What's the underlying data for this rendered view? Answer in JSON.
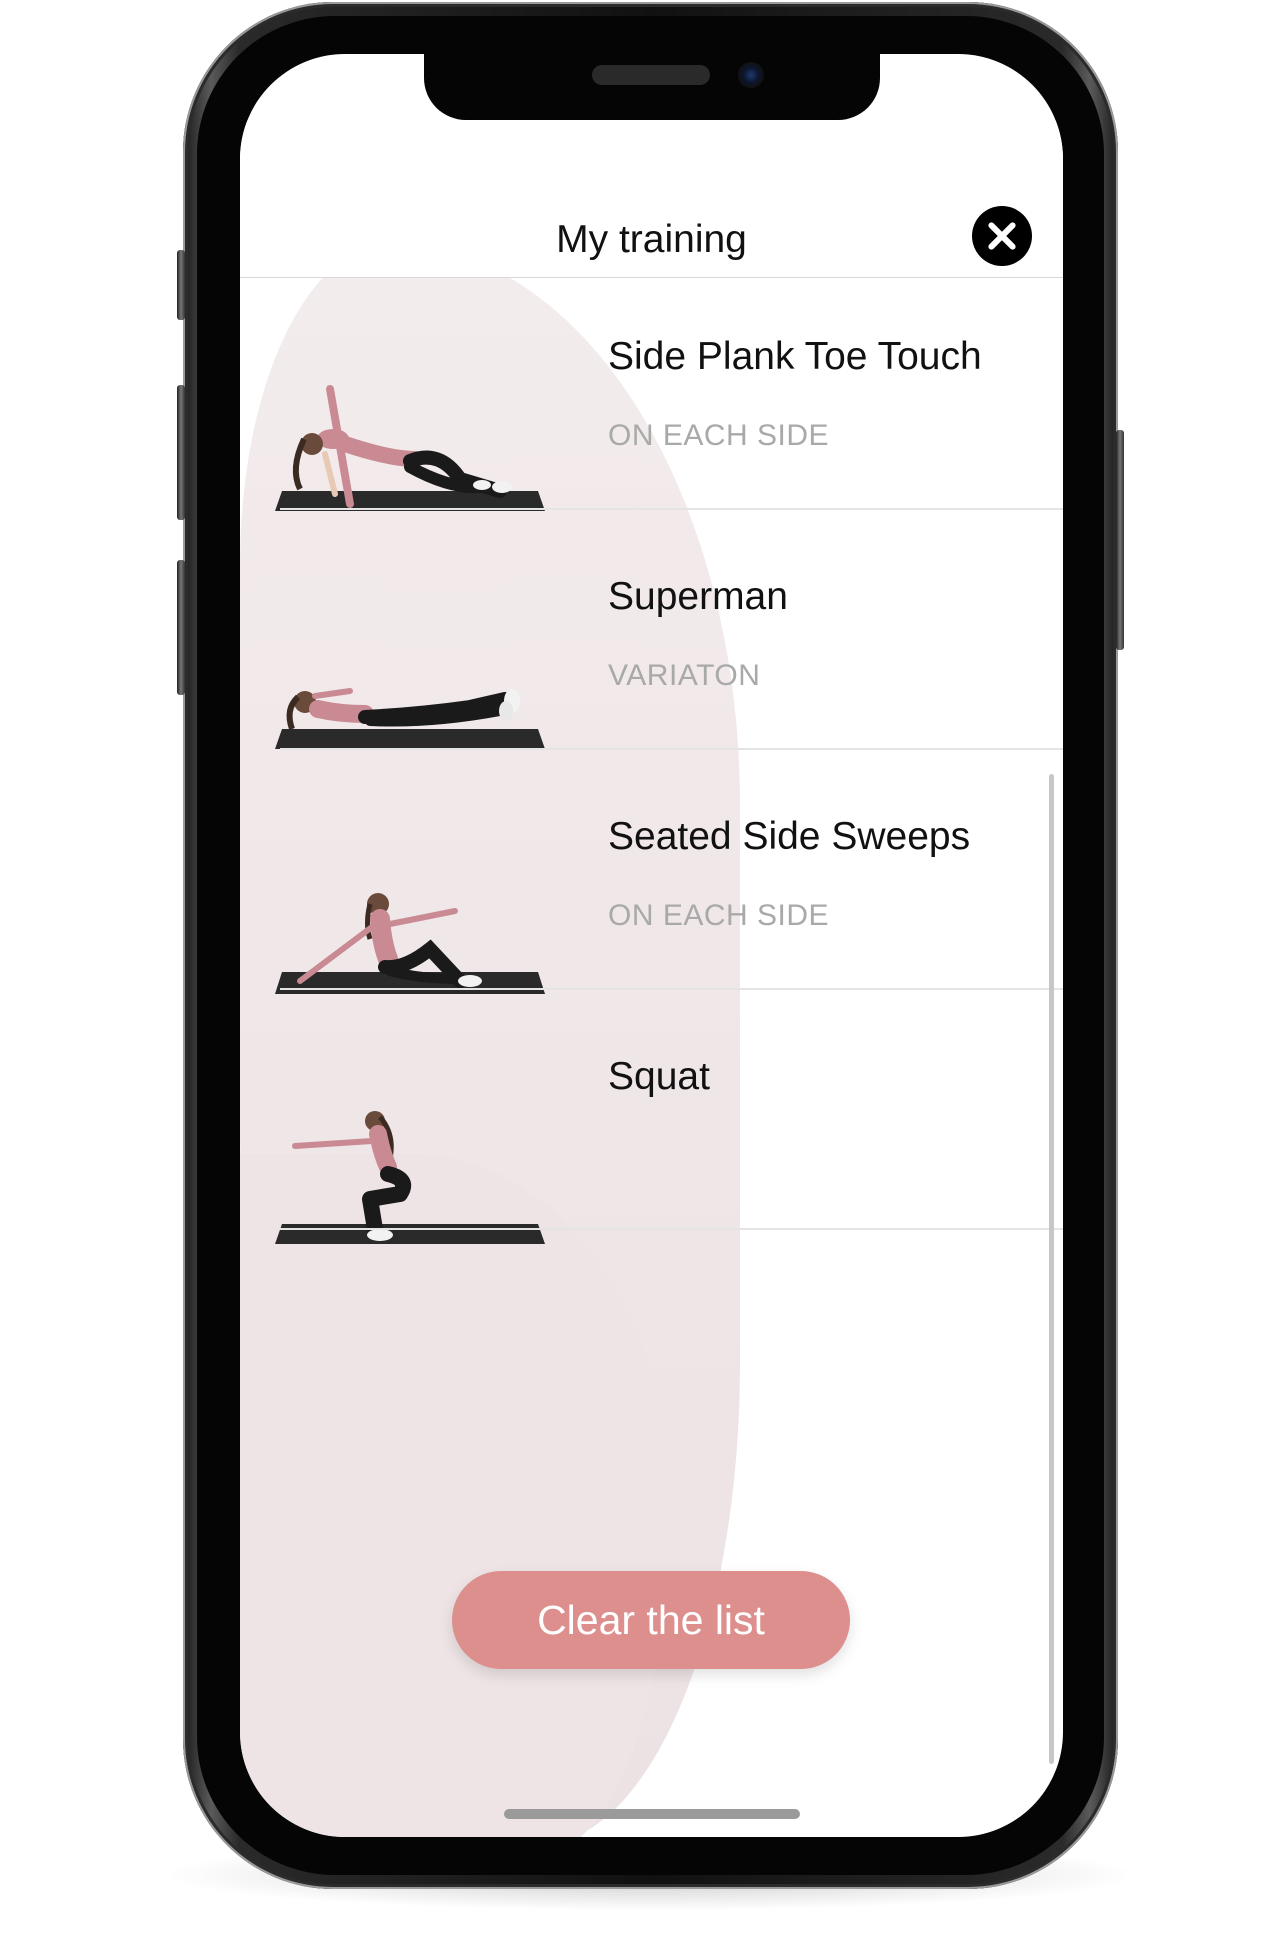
{
  "header": {
    "title": "My training"
  },
  "exercises": [
    {
      "name": "Side Plank Toe Touch",
      "subtitle": "ON EACH SIDE"
    },
    {
      "name": "Superman",
      "subtitle": "VARIATON"
    },
    {
      "name": "Seated Side Sweeps",
      "subtitle": "ON EACH SIDE"
    },
    {
      "name": "Squat",
      "subtitle": ""
    }
  ],
  "actions": {
    "clear_label": "Clear the list"
  },
  "colors": {
    "clear_button": "#dd8f8e",
    "shirt": "#c98a94",
    "pants": "#1a1a1a",
    "mat": "#2a2a2a"
  }
}
